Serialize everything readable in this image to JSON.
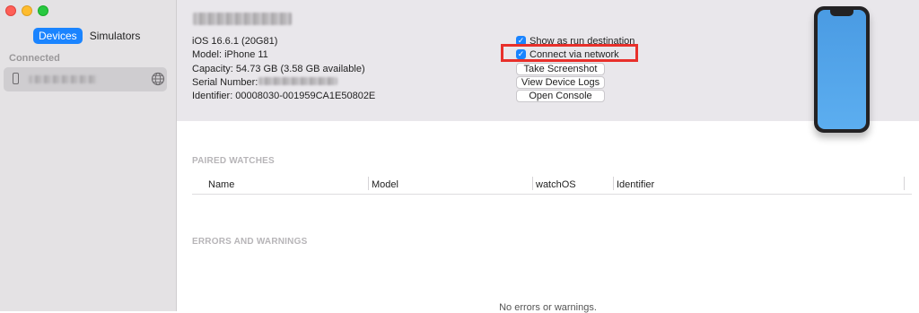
{
  "sidebar": {
    "tabs": {
      "devices": "Devices",
      "simulators": "Simulators"
    },
    "section": "Connected",
    "device_icon": "iphone-icon",
    "network_icon": "globe-icon"
  },
  "device": {
    "ios_version": "iOS 16.6.1 (20G81)",
    "model": "Model: iPhone 11",
    "capacity": "Capacity: 54.73 GB (3.58 GB available)",
    "serial_label": "Serial Number:",
    "identifier": "Identifier: 00008030-001959CA1E50802E"
  },
  "options": {
    "show_as_run_destination": {
      "label": "Show as run destination",
      "checked": true
    },
    "connect_via_network": {
      "label": "Connect via network",
      "checked": true
    }
  },
  "buttons": {
    "take_screenshot": "Take Screenshot",
    "view_device_logs": "View Device Logs",
    "open_console": "Open Console"
  },
  "paired_watches": {
    "title": "PAIRED WATCHES",
    "columns": [
      "Name",
      "Model",
      "watchOS",
      "Identifier"
    ]
  },
  "errors": {
    "title": "ERRORS AND WARNINGS",
    "empty": "No errors or warnings."
  },
  "colors": {
    "accent": "#1a84ff",
    "highlight": "#e8302b",
    "sidebar_bg": "#e4e2e4",
    "header_bg": "#e9e7eb"
  }
}
